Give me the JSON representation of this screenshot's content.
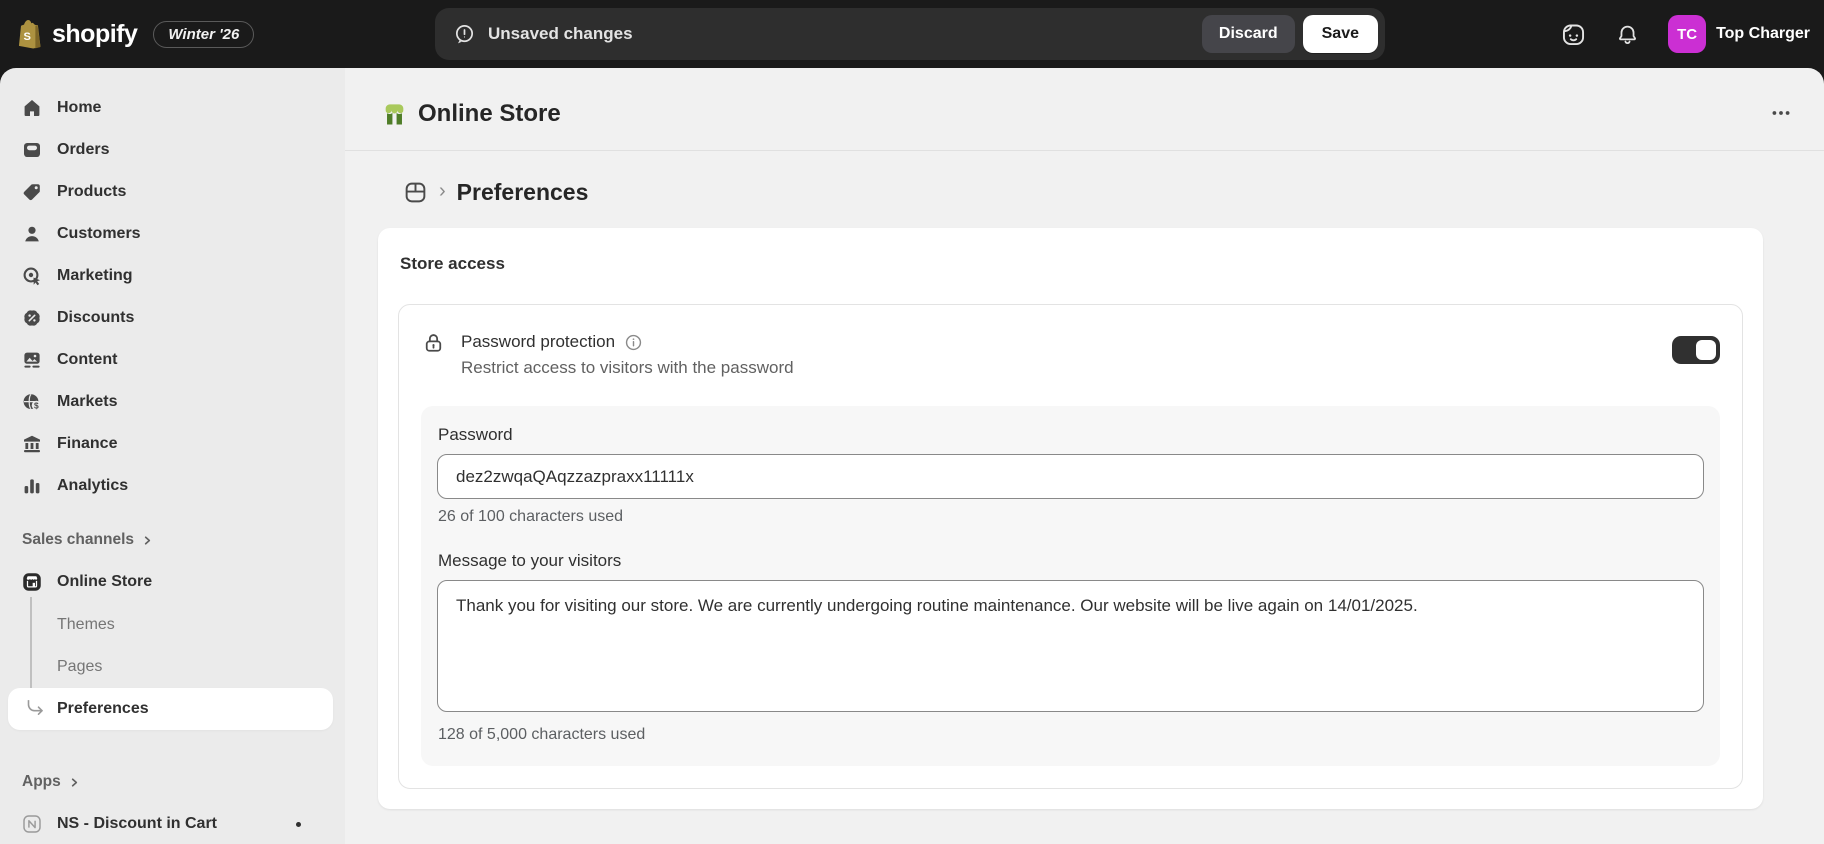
{
  "topbar": {
    "brand": {
      "logo": "shopify",
      "badge": "Winter '26"
    },
    "save_bar": {
      "message": "Unsaved changes",
      "discard_label": "Discard",
      "save_label": "Save"
    },
    "user": {
      "initials": "TC",
      "name": "Top Charger"
    }
  },
  "sidebar": {
    "items": [
      {
        "label": "Home"
      },
      {
        "label": "Orders"
      },
      {
        "label": "Products"
      },
      {
        "label": "Customers"
      },
      {
        "label": "Marketing"
      },
      {
        "label": "Discounts"
      },
      {
        "label": "Content"
      },
      {
        "label": "Markets"
      },
      {
        "label": "Finance"
      },
      {
        "label": "Analytics"
      }
    ],
    "sales_channels": {
      "label": "Sales channels"
    },
    "online_store": {
      "label": "Online Store"
    },
    "online_store_children": [
      {
        "label": "Themes"
      },
      {
        "label": "Pages"
      },
      {
        "label": "Preferences",
        "active": true
      }
    ],
    "apps": {
      "label": "Apps"
    },
    "app_items": [
      {
        "label": "NS - Discount in Cart"
      }
    ]
  },
  "main": {
    "page_title": "Online Store",
    "breadcrumb": {
      "current": "Preferences"
    },
    "store_access": {
      "title": "Store access",
      "password_protection": {
        "label": "Password protection",
        "description": "Restrict access to visitors with the password",
        "enabled": true
      },
      "password": {
        "label": "Password",
        "value": "dez2zwqaQAqzzazpraxx11111x",
        "helper": "26 of 100 characters used"
      },
      "message": {
        "label": "Message to your visitors",
        "value": "Thank you for visiting our store. We are currently undergoing routine maintenance. Our website will be live again on 14/01/2025.",
        "helper": "128 of 5,000 characters used"
      }
    }
  },
  "colors": {
    "topbar_bg": "#1a1a1a",
    "avatar_bg": "#cb2fd3",
    "toggle_on": "#303030",
    "store_icon_green_light": "#a9c95c",
    "store_icon_green_dark": "#4f7d28",
    "sidebar_bg": "#ebebeb",
    "content_bg": "#f1f1f1"
  }
}
